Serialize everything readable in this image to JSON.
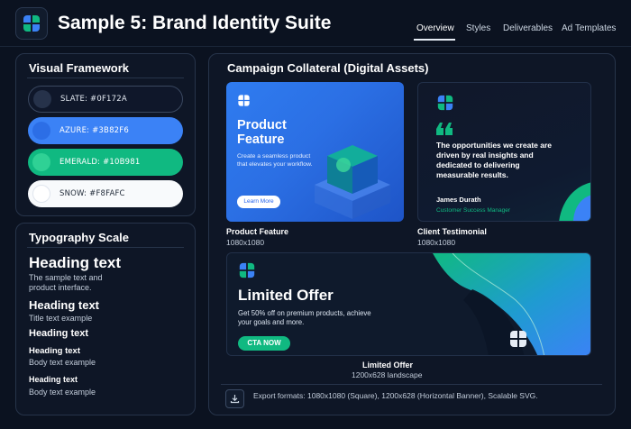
{
  "app": {
    "title": "Sample 5: Brand Identity Suite"
  },
  "tabs": [
    {
      "label": "Overview",
      "active": true
    },
    {
      "label": "Styles",
      "active": false
    },
    {
      "label": "Deliverables",
      "active": false
    },
    {
      "label": "Ad Templates",
      "active": false
    }
  ],
  "framework": {
    "title": "Visual Framework",
    "swatches": [
      {
        "label": "SLATE: #0F172A",
        "color": "#0F172A"
      },
      {
        "label": "AZURE: #3B82F6",
        "color": "#3B82F6"
      },
      {
        "label": "EMERALD: #10B981",
        "color": "#10B981"
      },
      {
        "label": "SNOW: #F8FAFC",
        "color": "#F8FAFC"
      }
    ]
  },
  "typography": {
    "title": "Typography Scale",
    "levels": [
      {
        "heading": "Heading text",
        "body": "The sample text and product interface."
      },
      {
        "heading": "Heading text",
        "body": "Title text example"
      },
      {
        "heading": "Heading text",
        "body": ""
      },
      {
        "heading": "Heading text",
        "body": "Body text example"
      },
      {
        "heading": "Heading text",
        "body": "Body text example"
      }
    ]
  },
  "campaign": {
    "title": "Campaign Collateral (Digital Assets)",
    "product": {
      "headline": "Product Feature",
      "body": "Create a seamless product that elevates your workflow.",
      "button": "Learn More",
      "caption": "Product Feature",
      "size": "1080x1080"
    },
    "testimonial": {
      "quote": "The opportunities we create are driven by real insights and dedicated to delivering measurable results.",
      "name": "James Durath",
      "role": "Customer Success Manager",
      "caption": "Client Testimonial",
      "size": "1080x1080"
    },
    "offer": {
      "headline": "Limited Offer",
      "body": "Get 50% off on premium products, achieve your goals and more.",
      "button": "CTA NOW",
      "caption": "Limited Offer",
      "size": "1200x628 landscape"
    },
    "export": "Export formats: 1080x1080 (Square), 1200x628 (Horizontal Banner), Scalable SVG."
  },
  "colors": {
    "azure": "#3B82F6",
    "emerald": "#10B981"
  }
}
